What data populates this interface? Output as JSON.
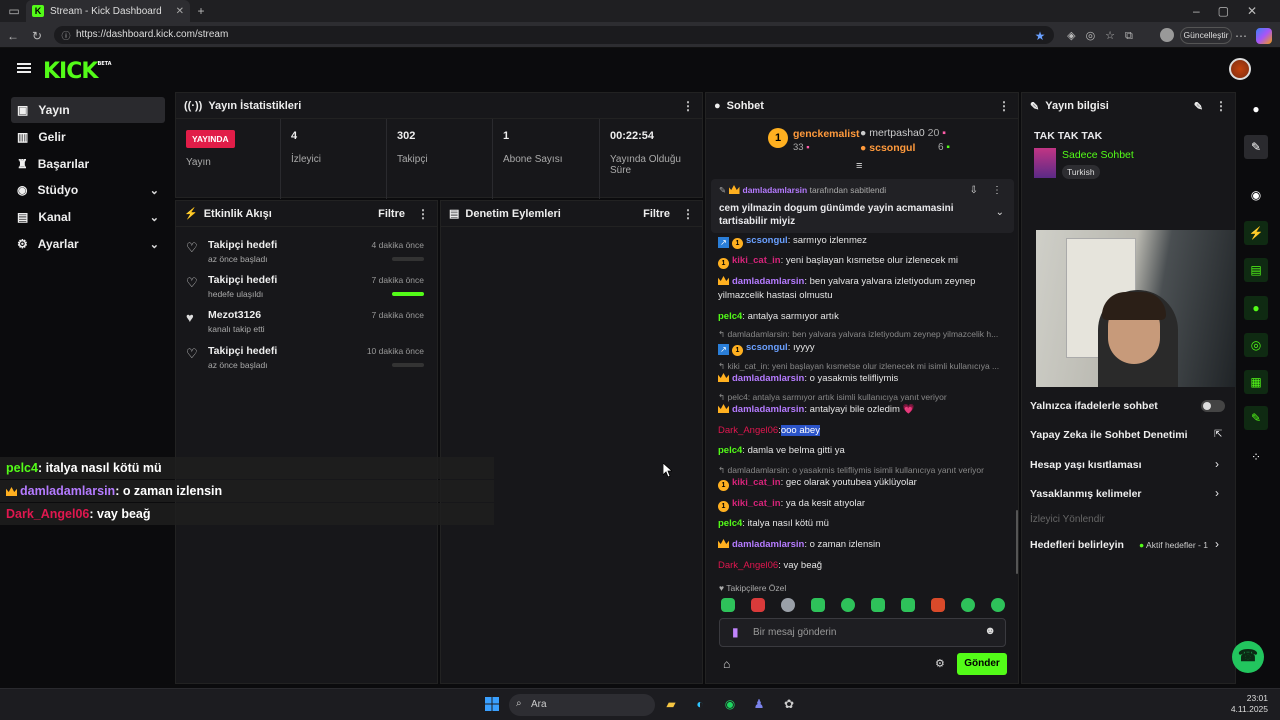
{
  "browser": {
    "tab_title": "Stream - Kick Dashboard",
    "url": "https://dashboard.kick.com/stream",
    "update_label": "Güncelleştir"
  },
  "app": {
    "logo": "KICK",
    "logo_badge": "BETA"
  },
  "sidebar": {
    "items": [
      {
        "label": "Yayın",
        "icon": "broadcast-icon",
        "active": true
      },
      {
        "label": "Gelir",
        "icon": "revenue-icon"
      },
      {
        "label": "Başarılar",
        "icon": "trophy-icon"
      },
      {
        "label": "Stüdyo",
        "icon": "studio-icon",
        "expandable": true
      },
      {
        "label": "Kanal",
        "icon": "channel-icon",
        "expandable": true
      },
      {
        "label": "Ayarlar",
        "icon": "gear-icon",
        "expandable": true
      }
    ]
  },
  "stats": {
    "title": "Yayın İstatistikleri",
    "live_badge": "YAYINDA",
    "cells": [
      {
        "value": "",
        "label": "Yayın"
      },
      {
        "value": "4",
        "label": "İzleyici"
      },
      {
        "value": "302",
        "label": "Takipçi"
      },
      {
        "value": "1",
        "label": "Abone Sayısı"
      },
      {
        "value": "00:22:54",
        "label": "Yayında Olduğu Süre"
      }
    ]
  },
  "activity": {
    "title": "Etkinlik Akışı",
    "filter": "Filtre",
    "items": [
      {
        "title": "Takipçi hedefi",
        "sub": "az önce başladı",
        "time": "4 dakika önce",
        "progress": 0
      },
      {
        "title": "Takipçi hedefi",
        "sub": "hedefe ulaşıldı",
        "time": "7 dakika önce",
        "progress": 1
      },
      {
        "title": "Mezot3126",
        "sub": "kanalı takip etti",
        "time": "7 dakika önce"
      },
      {
        "title": "Takipçi hedefi",
        "sub": "az önce başladı",
        "time": "10 dakika önce",
        "progress": 0
      }
    ]
  },
  "moderation": {
    "title": "Denetim Eylemleri",
    "filter": "Filtre"
  },
  "chat": {
    "title": "Sohbet",
    "leaderboard": {
      "first": {
        "name": "genckemalist",
        "rank": "1",
        "count": "33"
      },
      "second": {
        "name": "mertpasha0",
        "count": "20"
      },
      "third": {
        "name": "scsongul",
        "count": "6"
      }
    },
    "pinned": {
      "by_user": "damladamlarsin",
      "by_text": "tarafından sabitlendi",
      "text": "cem yilmazin dogum günümde yayin acmamasini tartisabilir miyiz"
    },
    "messages": [
      {
        "user": "scsongul",
        "text": ": sarmıyo izlenmez"
      },
      {
        "user": "kiki_cat_in",
        "text": ": yeni başlayan kısmetse olur izlenecek mi"
      },
      {
        "user": "damladamlarsin",
        "text": ": ben yalvara yalvara izletiyodum zeynep yilmazcelik hastasi olmustu"
      },
      {
        "user": "pelc4",
        "text": ": antalya sarmıyor artık"
      },
      {
        "reply": "damladamlarsin: ben yalvara yalvara izletiyodum zeynep yilmazcelik h..."
      },
      {
        "user": "scsongul",
        "text": ": ıyyyy"
      },
      {
        "reply": "kiki_cat_in: yeni başlayan kısmetse olur izlenecek mi isimli kullanıcıya ..."
      },
      {
        "user": "damladamlarsin",
        "text": ": o yasakmis telifliymis"
      },
      {
        "reply": "pelc4: antalya sarmıyor artık isimli kullanıcıya yanıt veriyor"
      },
      {
        "user": "damladamlarsin",
        "text": ": antalyayi bile ozledim 💗"
      },
      {
        "user": "Dark_Angel06",
        "text": ":",
        "highlight": "ooo abey"
      },
      {
        "user": "pelc4",
        "text": ": damla ve belma gitti ya"
      },
      {
        "reply": "damladamlarsin: o yasakmis telifliymis isimli kullanıcıya yanıt veriyor"
      },
      {
        "user": "kiki_cat_in",
        "text": ": gec olarak youtubea yüklüyolar"
      },
      {
        "user": "kiki_cat_in",
        "text": ": ya da kesit atıyolar"
      },
      {
        "user": "pelc4",
        "text": ": italya nasıl kötü mü"
      },
      {
        "user": "damladamlarsin",
        "text": ": o zaman izlensin"
      },
      {
        "user": "Dark_Angel06",
        "text": ": vay beağ"
      }
    ],
    "emote_section": "Takipçilere Özel",
    "input_placeholder": "Bir mesaj gönderin",
    "send_label": "Gönder"
  },
  "overlay": [
    {
      "user": "pelc4",
      "text": ": italya nasıl kötü mü"
    },
    {
      "user": "damladamlarsin",
      "text": ": o zaman izlensin"
    },
    {
      "user": "Dark_Angel06",
      "text": ": vay beağ"
    }
  ],
  "stream_info": {
    "title": "Yayın bilgisi",
    "stream_title": "TAK TAK TAK",
    "category": "Sadece Sohbet",
    "language": "Turkish",
    "settings": [
      {
        "label": "Yalnızca ifadelerle sohbet",
        "type": "toggle",
        "on": false
      },
      {
        "label": "Yapay Zeka ile Sohbet Denetimi",
        "type": "external"
      },
      {
        "label": "Hesap yaşı kısıtlaması",
        "type": "chevron"
      },
      {
        "label": "Yasaklanmış kelimeler",
        "type": "chevron"
      },
      {
        "label": "İzleyici Yönlendir",
        "type": "disabled"
      },
      {
        "label": "Hedefleri belirleyin",
        "type": "chevron",
        "badge": "Aktif hedefler - 1"
      }
    ]
  },
  "taskbar": {
    "search": "Ara",
    "time": "23:01",
    "date": "4.11.2025"
  },
  "colors": {
    "brand": "#53fc18",
    "live": "#e11d48"
  }
}
